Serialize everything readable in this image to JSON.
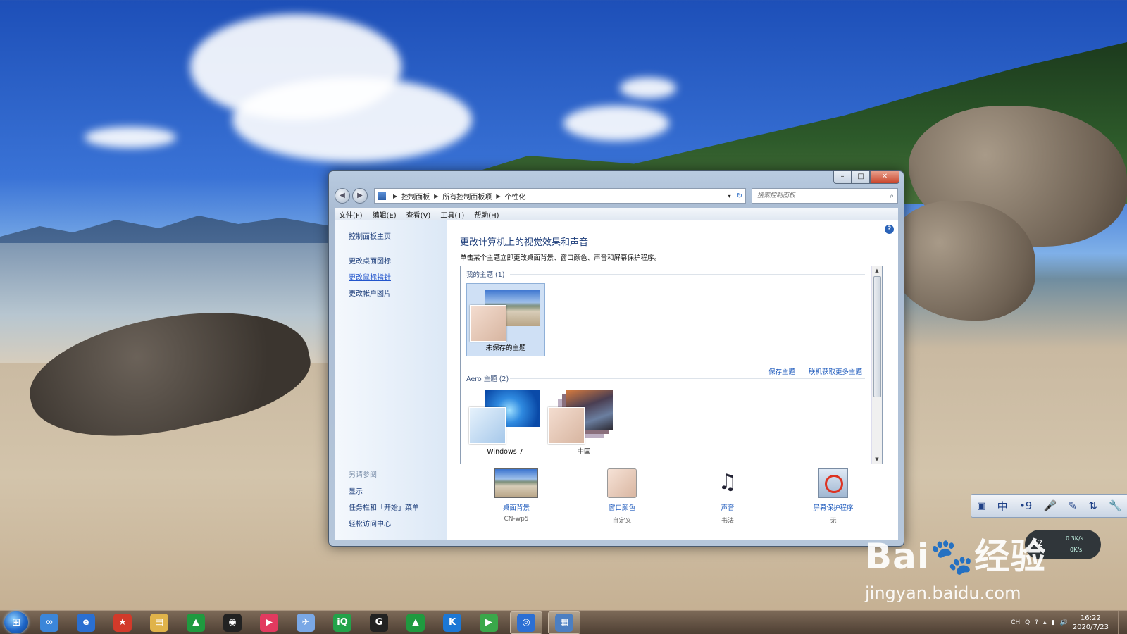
{
  "window": {
    "address": [
      "控制面板",
      "所有控制面板项",
      "个性化"
    ],
    "search_placeholder": "搜索控制面板",
    "menu": [
      "文件(F)",
      "编辑(E)",
      "查看(V)",
      "工具(T)",
      "帮助(H)"
    ],
    "controls": {
      "min": "–",
      "max": "□",
      "close": "✕"
    }
  },
  "sidebar": {
    "home": "控制面板主页",
    "links": [
      "更改桌面图标",
      "更改鼠标指针",
      "更改帐户图片"
    ],
    "see_also_heading": "另请参阅",
    "see_also": [
      "显示",
      "任务栏和「开始」菜单",
      "轻松访问中心"
    ]
  },
  "content": {
    "title": "更改计算机上的视觉效果和声音",
    "description": "单击某个主题立即更改桌面背景、窗口颜色、声音和屏幕保护程序。",
    "my_themes_label": "我的主题 (1)",
    "my_themes": [
      {
        "name": "未保存的主题",
        "selected": true
      }
    ],
    "actions": [
      "保存主题",
      "联机获取更多主题"
    ],
    "aero_label": "Aero 主题 (2)",
    "aero_themes": [
      {
        "name": "Windows 7"
      },
      {
        "name": "中国"
      }
    ]
  },
  "bottom": [
    {
      "label": "桌面背景",
      "value": "CN-wp5",
      "icon": "desktop-background-icon"
    },
    {
      "label": "窗口颜色",
      "value": "自定义",
      "icon": "window-color-icon"
    },
    {
      "label": "声音",
      "value": "书法",
      "icon": "sound-icon"
    },
    {
      "label": "屏幕保护程序",
      "value": "无",
      "icon": "screensaver-icon"
    }
  ],
  "langbar": [
    "中",
    "•9",
    "🎤",
    "✎",
    "⇅",
    "🔧"
  ],
  "netmon": {
    "percent": "42",
    "up": "0.3K/s",
    "down": "0K/s"
  },
  "watermark": {
    "brand": "Bai",
    "brand2": "经验",
    "url": "jingyan.baidu.com"
  },
  "taskbar": {
    "items": [
      {
        "name": "baidu-netdisk",
        "glyph": "∞",
        "color": "#3b86d9"
      },
      {
        "name": "internet-explorer",
        "glyph": "e",
        "color": "#2a6fd1"
      },
      {
        "name": "party-app",
        "glyph": "★",
        "color": "#d23a2a"
      },
      {
        "name": "file-explorer",
        "glyph": "▤",
        "color": "#e0b34a"
      },
      {
        "name": "green-app",
        "glyph": "▲",
        "color": "#1f9a3f"
      },
      {
        "name": "qq",
        "glyph": "◉",
        "color": "#222222"
      },
      {
        "name": "youku",
        "glyph": "▶",
        "color": "#e23a5f"
      },
      {
        "name": "bird-app",
        "glyph": "✈",
        "color": "#7aa8e6"
      },
      {
        "name": "iqiyi",
        "glyph": "iQ",
        "color": "#22a34a"
      },
      {
        "name": "g-app",
        "glyph": "G",
        "color": "#222222"
      },
      {
        "name": "green-app-2",
        "glyph": "▲",
        "color": "#1f9a3f"
      },
      {
        "name": "kugou",
        "glyph": "K",
        "color": "#1c78d6"
      },
      {
        "name": "player",
        "glyph": "▶",
        "color": "#3aa84a"
      },
      {
        "name": "browser",
        "glyph": "◎",
        "color": "#2b6fd4"
      },
      {
        "name": "control-panel",
        "glyph": "▦",
        "color": "#4c7fc2"
      }
    ],
    "tray": [
      "CH",
      "Q",
      "?",
      "▴",
      "▮",
      "🔊"
    ],
    "time": "16:22",
    "date": "2020/7/23"
  }
}
